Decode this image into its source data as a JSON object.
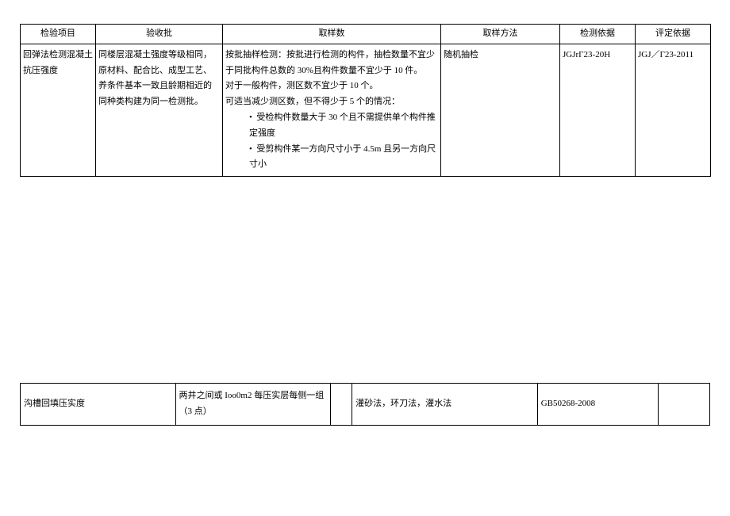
{
  "table1": {
    "headers": {
      "item": "检验项目",
      "batch": "验收批",
      "samples": "取样数",
      "method": "取样方法",
      "detect_basis": "检测依据",
      "eval_basis": "评定依据"
    },
    "row": {
      "item": "回弹法检测混凝土抗压强度",
      "batch": "同楼层混凝土强度等级相同，原材料、配合比、成型工艺、养条件基本一致且龄期相近的同种类构建为同一检测批。",
      "samples_line1": "按批抽样检测：按批进行检测的构件，抽检数量不宜少于同批构件总数的 30%且构件数量不宜少于 10 件。",
      "samples_line2": "对于一般构件，测区数不宜少于 10 个。",
      "samples_line3": "可适当减少测区数，但不得少于 5 个的情况：",
      "bullet1": "受检构件数量大于 30 个且不需提供单个构件推定强度",
      "bullet2": "受剪构件某一方向尺寸小于 4.5m 且另一方向尺寸小",
      "method": "随机抽检",
      "detect_basis": "JGJrΓ23-20H",
      "eval_basis": "JGJ／Γ23-2011"
    }
  },
  "table2": {
    "row": {
      "c1": "沟槽回填压实度",
      "c2": "两井之间或 Ioo0m2 每压实层每侧一组（3 点）",
      "c3": "",
      "c4": "灌砂法，环刀法，灌水法",
      "c5": "GB50268-2008",
      "c6": ""
    }
  }
}
